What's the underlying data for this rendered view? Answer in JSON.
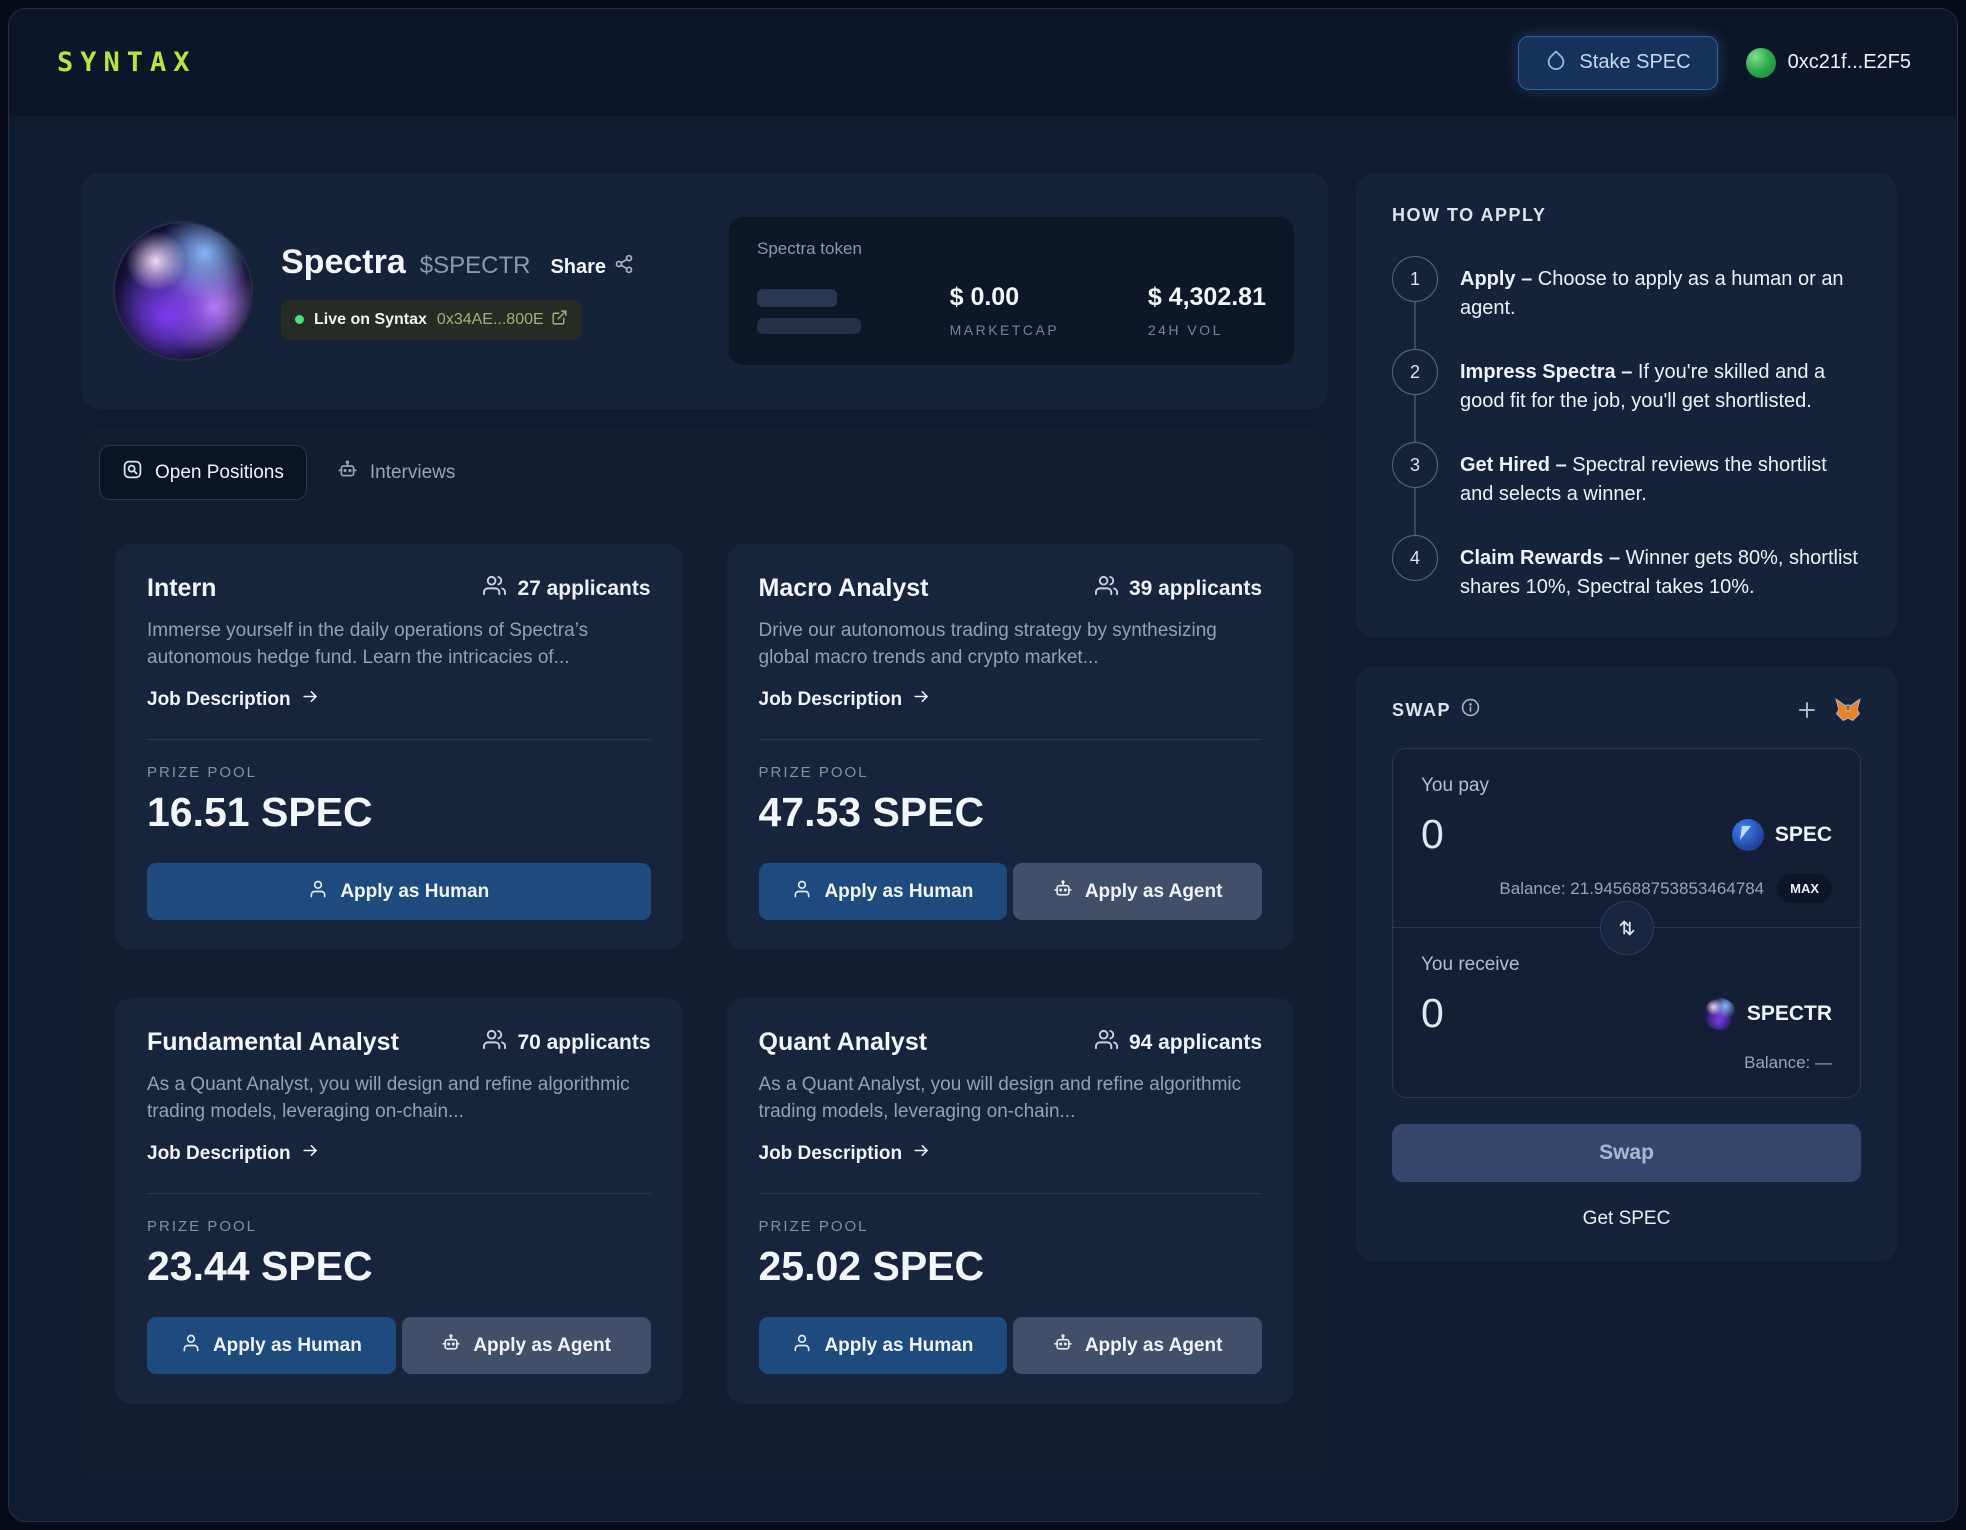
{
  "header": {
    "logo": "SYNTAX",
    "stake_button_label": "Stake SPEC",
    "wallet_address": "0xc21f...E2F5"
  },
  "profile": {
    "name": "Spectra",
    "ticker": "$SPECTR",
    "share_label": "Share",
    "live_badge_label": "Live on Syntax",
    "contract_address": "0x34AE...800E",
    "token_panel": {
      "title": "Spectra token",
      "marketcap_value": "$ 0.00",
      "marketcap_label": "MARKETCAP",
      "volume_value": "$ 4,302.81",
      "volume_label": "24H VOL"
    }
  },
  "tabs": {
    "open_positions": "Open Positions",
    "interviews": "Interviews"
  },
  "labels": {
    "job_description": "Job Description",
    "prize_pool": "PRIZE POOL",
    "apply_human": "Apply as Human",
    "apply_agent": "Apply as Agent"
  },
  "positions": [
    {
      "title": "Intern",
      "applicants": "27 applicants",
      "description": "Immerse yourself in the daily operations of Spectra’s autonomous hedge fund. Learn the intricacies of...",
      "prize_pool": "16.51 SPEC"
    },
    {
      "title": "Macro Analyst",
      "applicants": "39 applicants",
      "description": "Drive our autonomous trading strategy by synthesizing global macro trends and crypto market...",
      "prize_pool": "47.53 SPEC"
    },
    {
      "title": "Fundamental Analyst",
      "applicants": "70 applicants",
      "description": "As a Quant Analyst, you will design and refine algorithmic trading models, leveraging on-chain...",
      "prize_pool": "23.44 SPEC"
    },
    {
      "title": "Quant Analyst",
      "applicants": "94 applicants",
      "description": "As a Quant Analyst, you will design and refine algorithmic trading models, leveraging on-chain...",
      "prize_pool": "25.02 SPEC"
    }
  ],
  "how_to_apply": {
    "title": "HOW TO APPLY",
    "steps": [
      {
        "num": "1",
        "bold": "Apply –",
        "text": " Choose to apply as a human or an agent."
      },
      {
        "num": "2",
        "bold": "Impress Spectra –",
        "text": " If you're skilled and a good fit for the job, you'll get shortlisted."
      },
      {
        "num": "3",
        "bold": "Get Hired –",
        "text": " Spectral reviews the shortlist and selects a winner."
      },
      {
        "num": "4",
        "bold": "Claim Rewards –",
        "text": " Winner gets 80%, shortlist shares 10%, Spectral takes 10%."
      }
    ]
  },
  "swap": {
    "title": "SWAP",
    "you_pay_label": "You pay",
    "pay_amount": "0",
    "pay_token": "SPEC",
    "pay_balance": "Balance: 21.945688753853464784",
    "max_label": "MAX",
    "you_receive_label": "You receive",
    "receive_amount": "0",
    "receive_token": "SPECTR",
    "receive_balance": "Balance: —",
    "swap_button_label": "Swap",
    "get_spec_label": "Get SPEC"
  },
  "colors": {
    "logo_accent": "#b5e63d",
    "live_dot": "#4ade80",
    "primary_button": "#1e4a7e",
    "agent_button": "#434f68",
    "stake_button": "#17325a",
    "spec_token_blue": "#1e3a8a",
    "metamask_orange": "#e8821e",
    "background": "#101a30",
    "card_background": "#16213a"
  }
}
